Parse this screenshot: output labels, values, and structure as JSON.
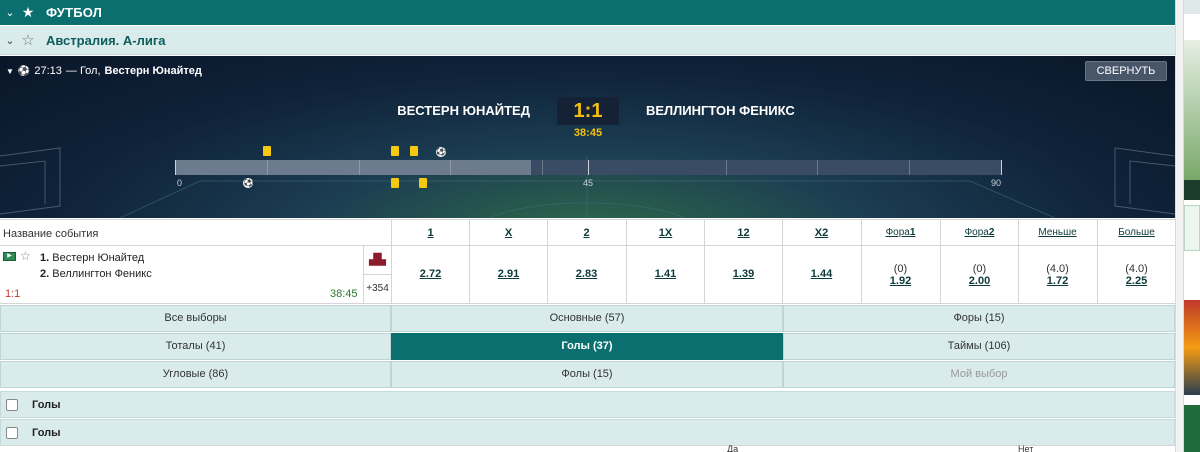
{
  "sport_header": {
    "title": "ФУТБОЛ",
    "chevron": "⌄",
    "star": "★"
  },
  "league_header": {
    "title": "Австралия. А-лига",
    "chevron": "⌄",
    "star": "☆"
  },
  "scoreboard": {
    "event_time": "27:13",
    "event_text": " — Гол, ",
    "event_team": "Вестерн Юнайтед",
    "collapse_label": "СВЕРНУТЬ",
    "team1": "ВЕСТЕРН ЮНАЙТЕД",
    "team2": "ВЕЛЛИНГТОН ФЕНИКС",
    "score": "1:1",
    "match_time": "38:45",
    "timeline": {
      "labels": [
        "0",
        "45",
        "90"
      ],
      "progress_minutes": 38.75,
      "total_minutes": 90,
      "events_above": [
        {
          "type": "yellow-card",
          "minute": 10
        },
        {
          "type": "yellow-card",
          "minute": 24
        },
        {
          "type": "yellow-card",
          "minute": 26
        },
        {
          "type": "goal",
          "minute": 29
        }
      ],
      "events_below": [
        {
          "type": "goal",
          "minute": 8
        },
        {
          "type": "yellow-card",
          "minute": 24
        },
        {
          "type": "yellow-card",
          "minute": 27
        }
      ]
    }
  },
  "odds_table": {
    "name_header": "Название события",
    "headers": [
      {
        "text": "1"
      },
      {
        "text": "X"
      },
      {
        "text": "2"
      },
      {
        "text": "1X"
      },
      {
        "text": "12"
      },
      {
        "text": "X2"
      },
      {
        "text": "Фора",
        "bold": "1"
      },
      {
        "text": "Фора",
        "bold": "2"
      },
      {
        "text": "Меньше"
      },
      {
        "text": "Больше"
      }
    ],
    "event": {
      "team1_num": "1.",
      "team1": " Вестерн Юнайтед",
      "team2_num": "2.",
      "team2": " Веллингтон Феникс",
      "score": "1:1",
      "time": "38:45",
      "more": "+354"
    },
    "odds": [
      {
        "value": "2.72"
      },
      {
        "value": "2.91"
      },
      {
        "value": "2.83"
      },
      {
        "value": "1.41"
      },
      {
        "value": "1.39"
      },
      {
        "value": "1.44"
      },
      {
        "handicap": "(0)",
        "value": "1.92"
      },
      {
        "handicap": "(0)",
        "value": "2.00"
      },
      {
        "handicap": "(4.0)",
        "value": "1.72"
      },
      {
        "handicap": "(4.0)",
        "value": "2.25"
      }
    ]
  },
  "tabs": [
    {
      "label": "Все выборы",
      "state": "normal"
    },
    {
      "label": "Основные (57)",
      "state": "normal"
    },
    {
      "label": "Форы (15)",
      "state": "normal"
    },
    {
      "label": "Тоталы (41)",
      "state": "normal"
    },
    {
      "label": "Голы (37)",
      "state": "active"
    },
    {
      "label": "Таймы (106)",
      "state": "normal"
    },
    {
      "label": "Угловые (86)",
      "state": "normal"
    },
    {
      "label": "Фолы (15)",
      "state": "normal"
    },
    {
      "label": "Мой выбор",
      "state": "muted"
    }
  ],
  "sections": [
    {
      "label": "Голы"
    },
    {
      "label": "Голы"
    }
  ],
  "bottom_row": {
    "c1": "Да",
    "c2": "Нет"
  },
  "colors": {
    "primary": "#0a6f6e",
    "light": "#d9ebeb",
    "score_yellow": "#f2c012",
    "card_yellow": "#f5c90f"
  }
}
